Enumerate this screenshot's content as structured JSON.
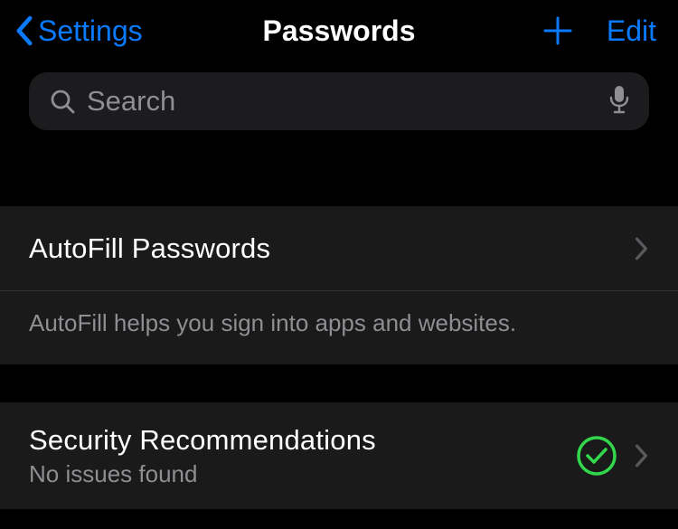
{
  "nav": {
    "back_label": "Settings",
    "title": "Passwords",
    "edit_label": "Edit"
  },
  "search": {
    "placeholder": "Search"
  },
  "autofill": {
    "title": "AutoFill Passwords",
    "footer": "AutoFill helps you sign into apps and websites."
  },
  "security": {
    "title": "Security Recommendations",
    "subtitle": "No issues found"
  },
  "colors": {
    "accent": "#0a7aff",
    "success": "#32d74b"
  }
}
